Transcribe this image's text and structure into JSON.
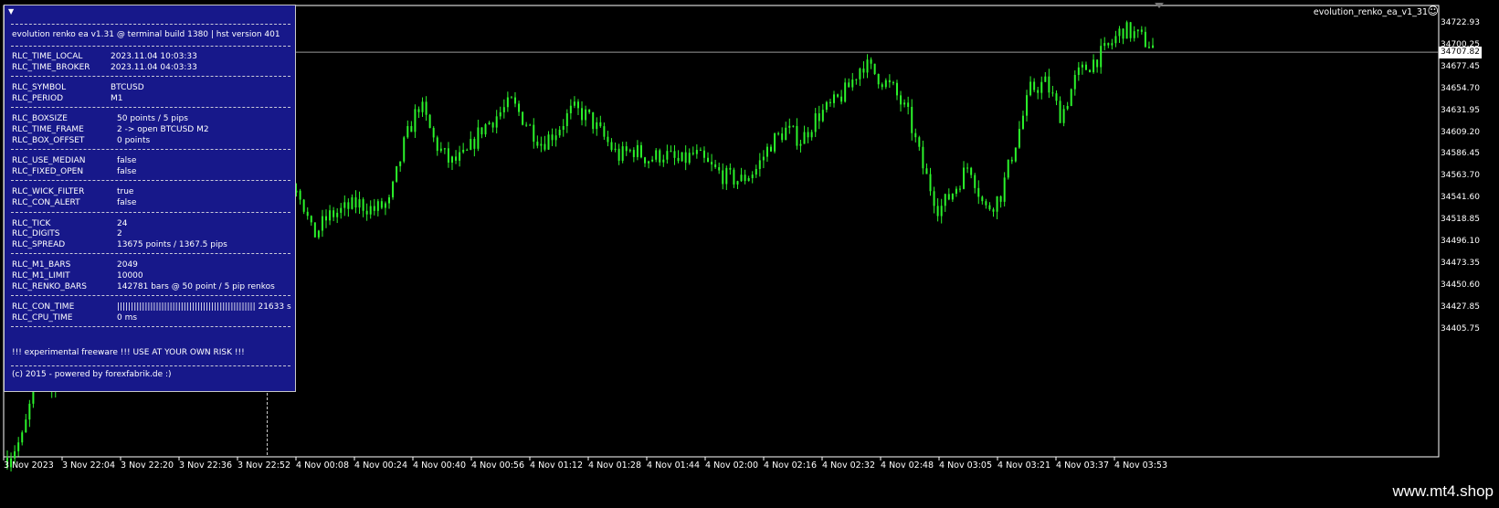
{
  "chart": {
    "ea_label": "evolution_renko_ea_v1_31",
    "smiley": "☺",
    "current_price": "34707.82",
    "price_axis": [
      "34722.93",
      "34700.25",
      "34677.45",
      "34654.70",
      "34631.95",
      "34609.20",
      "34586.45",
      "34563.70",
      "34541.60",
      "34518.85",
      "34496.10",
      "34473.35",
      "34450.60",
      "34427.85",
      "34405.75"
    ],
    "time_axis": [
      "3 Nov 2023",
      "3 Nov 22:04",
      "3 Nov 22:20",
      "3 Nov 22:36",
      "3 Nov 22:52",
      "4 Nov 00:08",
      "4 Nov 00:24",
      "4 Nov 00:40",
      "4 Nov 00:56",
      "4 Nov 01:12",
      "4 Nov 01:28",
      "4 Nov 01:44",
      "4 Nov 02:00",
      "4 Nov 02:16",
      "4 Nov 02:32",
      "4 Nov 02:48",
      "4 Nov 03:05",
      "4 Nov 03:21",
      "4 Nov 03:37",
      "4 Nov 03:53"
    ],
    "colors": {
      "candle": "#2bf32b",
      "background": "#000000",
      "axis": "#ffffff"
    }
  },
  "chart_data": {
    "type": "line",
    "x_label": "",
    "y_label": "",
    "ylim": [
      34405.75,
      34722.93
    ],
    "series": [
      {
        "values": [
          34405,
          34420,
          34470,
          34455,
          34520,
          34560,
          34545,
          34525,
          34510,
          34530,
          34545,
          34520,
          34540,
          34555,
          34560,
          34548,
          34570,
          34580,
          34600,
          34610,
          34570,
          34585,
          34590,
          34595,
          34590,
          34595,
          34640,
          34670,
          34640,
          34625,
          34630,
          34650,
          34660,
          34670,
          34655,
          34640,
          34650,
          34665,
          34660,
          34645,
          34630,
          34635,
          34628,
          34632,
          34625,
          34632,
          34622,
          34615,
          34612,
          34620,
          34640,
          34650,
          34642,
          34660,
          34668,
          34680,
          34700,
          34690,
          34680,
          34660,
          34620,
          34590,
          34605,
          34625,
          34590,
          34600,
          34640,
          34680,
          34685,
          34660,
          34690,
          34700,
          34710,
          34725,
          34720,
          34712
        ]
      }
    ]
  },
  "panel": {
    "header": "evolution renko ea v1.31 @ terminal build 1380 | hst version 401",
    "groups": [
      [
        [
          "RLC_TIME_LOCAL",
          "2023.11.04 10:03:33"
        ],
        [
          "RLC_TIME_BROKER",
          "2023.11.04 04:03:33"
        ]
      ],
      [
        [
          "RLC_SYMBOL",
          "BTCUSD"
        ],
        [
          "RLC_PERIOD",
          "M1"
        ]
      ],
      [
        [
          "RLC_BOXSIZE",
          "50 points / 5 pips"
        ],
        [
          "RLC_TIME_FRAME",
          "2 -> open BTCUSD M2"
        ],
        [
          "RLC_BOX_OFFSET",
          "0 points"
        ]
      ],
      [
        [
          "RLC_USE_MEDIAN",
          "false"
        ],
        [
          "RLC_FIXED_OPEN",
          "false"
        ]
      ],
      [
        [
          "RLC_WICK_FILTER",
          "true"
        ],
        [
          "RLC_CON_ALERT",
          "false"
        ]
      ],
      [
        [
          "RLC_TICK",
          "24"
        ],
        [
          "RLC_DIGITS",
          "2"
        ],
        [
          "RLC_SPREAD",
          "13675 points / 1367.5 pips"
        ]
      ],
      [
        [
          "RLC_M1_BARS",
          "2049"
        ],
        [
          "RLC_M1_LIMIT",
          "10000"
        ],
        [
          "RLC_RENKO_BARS",
          "142781 bars @ 50 point / 5 pip renkos"
        ]
      ],
      [
        [
          "RLC_CON_TIME",
          "|||||||||||||||||||||||||||||||||||||||||||||||||| 21633 s"
        ],
        [
          "RLC_CPU_TIME",
          "0 ms"
        ]
      ]
    ],
    "footer1": "!!! experimental freeware !!! USE AT YOUR OWN RISK !!!",
    "footer2": "(c) 2015 - powered by forexfabrik.de :)"
  },
  "watermark": "www.mt4.shop"
}
